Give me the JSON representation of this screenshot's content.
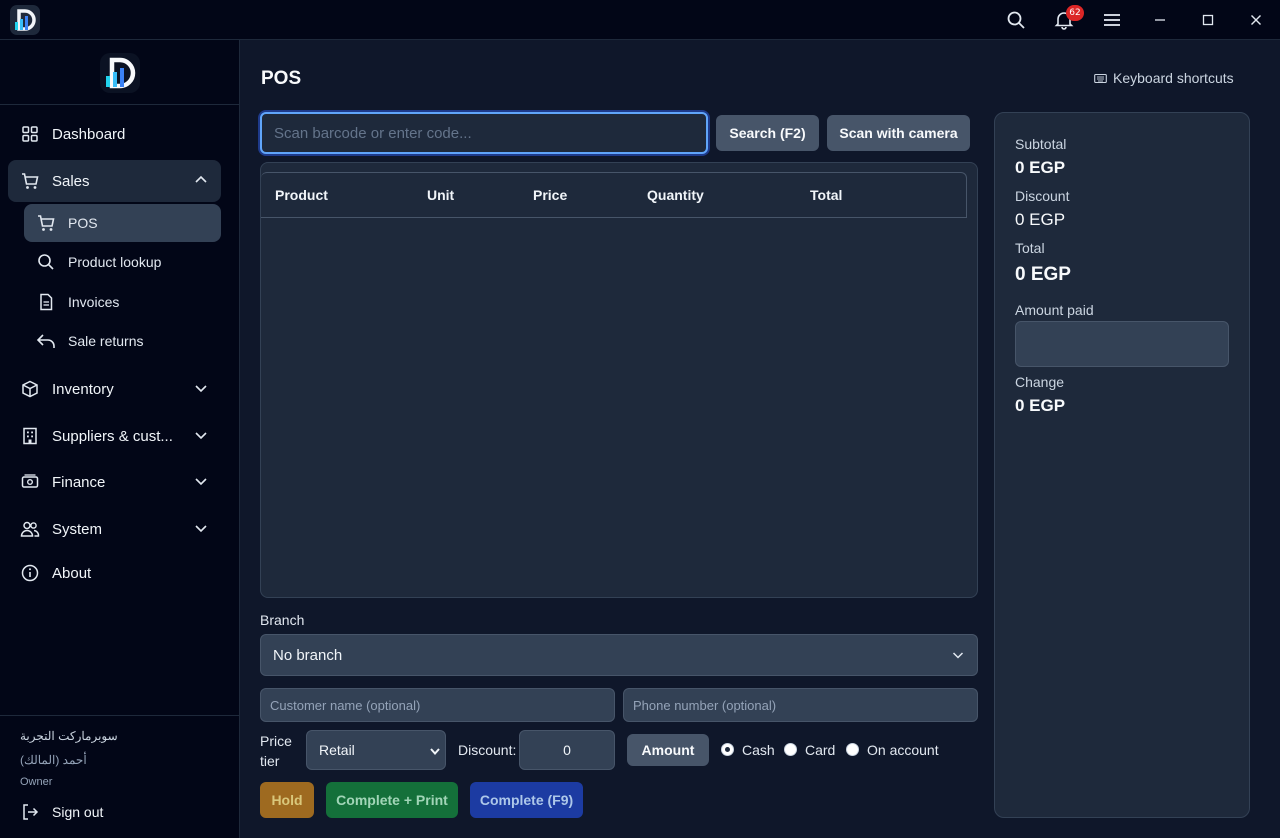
{
  "titlebar": {
    "notification_count": "62"
  },
  "sidebar": {
    "items": [
      {
        "label": "Dashboard"
      },
      {
        "label": "Sales"
      },
      {
        "label": "Inventory"
      },
      {
        "label": "Suppliers & cust..."
      },
      {
        "label": "Finance"
      },
      {
        "label": "System"
      },
      {
        "label": "About"
      }
    ],
    "sales_sub": [
      {
        "label": "POS"
      },
      {
        "label": "Product lookup"
      },
      {
        "label": "Invoices"
      },
      {
        "label": "Sale returns"
      }
    ],
    "footer": {
      "store_name": "سوبرماركت التجربة",
      "user_name": "أحمد (المالك)",
      "role": "Owner",
      "sign_out": "Sign out"
    }
  },
  "main": {
    "title": "POS",
    "keyboard_shortcuts": "Keyboard shortcuts",
    "scan_placeholder": "Scan barcode or enter code...",
    "search_button": "Search (F2)",
    "camera_button": "Scan with camera",
    "table_headers": [
      "Product",
      "Unit",
      "Price",
      "Quantity",
      "Total"
    ],
    "branch_label": "Branch",
    "branch_value": "No branch",
    "customer_placeholder": "Customer name (optional)",
    "phone_placeholder": "Phone number (optional)",
    "price_tier_label": "Price tier",
    "price_tier_value": "Retail",
    "discount_label": "Discount:",
    "discount_value": "0",
    "amount_button": "Amount",
    "payment_methods": [
      "Cash",
      "Card",
      "On account"
    ],
    "selected_payment": "Cash",
    "hold_button": "Hold",
    "complete_print_button": "Complete + Print",
    "complete_button": "Complete (F9)"
  },
  "summary": {
    "subtotal_label": "Subtotal",
    "subtotal_value": "0 EGP",
    "discount_label": "Discount",
    "discount_value": "0 EGP",
    "total_label": "Total",
    "total_value": "0 EGP",
    "amount_paid_label": "Amount paid",
    "amount_paid_value": "",
    "change_label": "Change",
    "change_value": "0 EGP"
  },
  "colors": {
    "accent_blue": "#60a5fa",
    "hold": "#b7791f",
    "complete_print": "#15803d",
    "complete": "#1e40af"
  }
}
